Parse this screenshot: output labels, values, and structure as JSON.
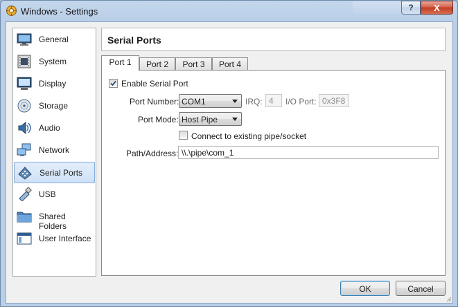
{
  "window": {
    "title": "Windows - Settings",
    "help_label": "?",
    "close_label": "X"
  },
  "sidebar": {
    "items": [
      {
        "label": "General",
        "icon": "monitor-icon"
      },
      {
        "label": "System",
        "icon": "chip-icon"
      },
      {
        "label": "Display",
        "icon": "display-icon"
      },
      {
        "label": "Storage",
        "icon": "disk-icon"
      },
      {
        "label": "Audio",
        "icon": "speaker-icon"
      },
      {
        "label": "Network",
        "icon": "network-icon"
      },
      {
        "label": "Serial Ports",
        "icon": "serial-port-icon",
        "selected": true
      },
      {
        "label": "USB",
        "icon": "usb-icon"
      },
      {
        "label": "Shared Folders",
        "icon": "folder-icon"
      },
      {
        "label": "User Interface",
        "icon": "window-icon"
      }
    ]
  },
  "header": {
    "title": "Serial Ports"
  },
  "tabs": [
    {
      "label": "Port 1",
      "active": true
    },
    {
      "label": "Port 2"
    },
    {
      "label": "Port 3"
    },
    {
      "label": "Port 4"
    }
  ],
  "port": {
    "enable_label": "Enable Serial Port",
    "enabled": true,
    "port_number_label": "Port Number:",
    "port_number_value": "COM1",
    "irq_label": "IRQ:",
    "irq_value": "4",
    "io_port_label": "I/O Port:",
    "io_port_value": "0x3F8",
    "port_mode_label": "Port Mode:",
    "port_mode_value": "Host Pipe",
    "connect_label": "Connect to existing pipe/socket",
    "connect_checked": false,
    "path_label": "Path/Address:",
    "path_value": "\\\\.\\pipe\\com_1"
  },
  "buttons": {
    "ok": "OK",
    "cancel": "Cancel"
  },
  "colors": {
    "selection": "#cfe1f7",
    "selection_border": "#84acdd",
    "title_bar": "#b9cfe8",
    "close": "#c03d23"
  }
}
